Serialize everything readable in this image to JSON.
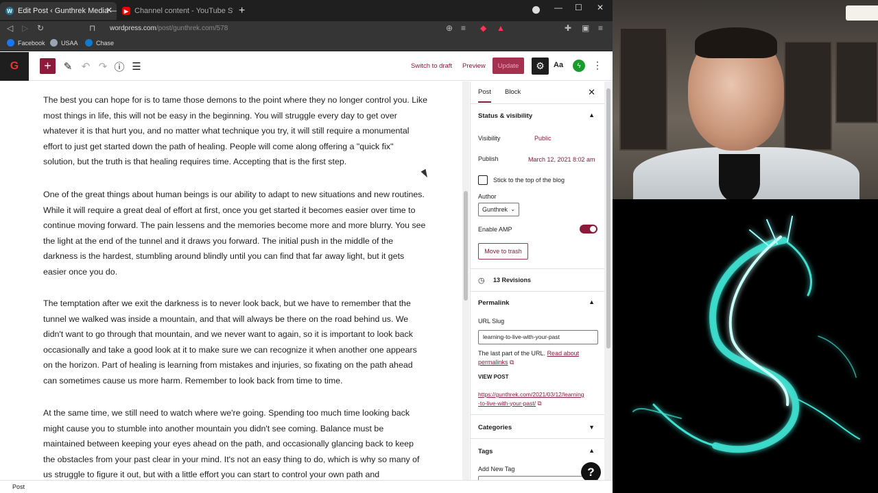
{
  "browser": {
    "tabs": [
      {
        "title": "Edit Post ‹ Gunthrek Media — W",
        "active": true
      },
      {
        "title": "Channel content - YouTube Studio",
        "active": false
      }
    ],
    "url": {
      "host": "wordpress.com",
      "path": "/post/gunthrek.com/578"
    },
    "bookmarks": [
      {
        "label": "Facebook",
        "color": "#1877f2"
      },
      {
        "label": "USAA",
        "color": "#9aa4b5"
      },
      {
        "label": "Chase",
        "color": "#117aca"
      }
    ]
  },
  "editor": {
    "logo_letter": "G",
    "toolbar": {
      "switch_to_draft": "Switch to draft",
      "preview": "Preview",
      "update": "Update",
      "typography": "Aa"
    },
    "paragraphs": [
      "The best you can hope for is to tame those demons to the point where they no longer control you.  Like most things in life, this will not be easy in the beginning.  You will struggle every day to get over whatever it is that hurt you, and no matter what technique you try, it will still require a monumental effort to just get started down the path of healing.  People will come along offering a \"quick fix\" solution, but the truth is that healing requires time.  Accepting that is the first step.",
      "One of the great things about human beings is our ability to adapt to new situations and new routines.  While it will require a great deal of effort at first, once you get started it becomes easier over time to continue moving forward.  The pain lessens and the memories become more and more blurry.  You see the light at the end of the tunnel and it draws you forward.  The initial push in the middle of the darkness is the hardest, stumbling around blindly until you can find that far away light, but it gets easier once you do.",
      "The temptation after we exit the darkness is to never look back, but we have to remember that the tunnel we walked was inside a mountain, and that will always be there on the road behind us.  We didn't want to go through that mountain, and we never want to again, so it is important to look back occasionally and take a good look at it to make sure we can recognize it when another one appears on the horizon.  Part of healing is learning from mistakes and injuries, so fixating on the path ahead can sometimes cause us more harm.  Remember to look back from time to time.",
      "At the same time, we still need to watch where we're going.  Spending too much time looking back might cause you to stumble into another mountain you didn't see coming.  Balance must be maintained between keeping your eyes ahead on the path, and occasionally glancing back to keep the obstacles from your past clear in your mind.  It's not an easy thing to do, which is why so many of us struggle to figure it out, but with a little effort you can start to control your own path and"
    ],
    "footer_breadcrumb": "Post"
  },
  "sidebar": {
    "tabs": {
      "post": "Post",
      "block": "Block"
    },
    "status": {
      "heading": "Status & visibility",
      "visibility_label": "Visibility",
      "visibility_value": "Public",
      "publish_label": "Publish",
      "publish_value": "March 12, 2021 8:02 am",
      "sticky_label": "Stick to the top of the blog",
      "sticky_checked": false,
      "author_label": "Author",
      "author_value": "Gunthrek",
      "amp_label": "Enable AMP",
      "amp_enabled": true,
      "trash_label": "Move to trash"
    },
    "revisions": "13 Revisions",
    "permalink": {
      "heading": "Permalink",
      "slug_label": "URL Slug",
      "slug_value": "learning-to-live-with-your-past",
      "help_text": "The last part of the URL.",
      "help_link": "Read about permalinks",
      "view_post_label": "VIEW POST",
      "url_line1": "https://gunthrek.com/2021/03/12/learning",
      "url_line2": "-to-live-with-your-past/"
    },
    "categories_heading": "Categories",
    "tags_heading": "Tags",
    "add_tag_label": "Add New Tag"
  },
  "colors": {
    "accent": "#8b1a3b",
    "logo_glow": "#3fe0d0"
  }
}
